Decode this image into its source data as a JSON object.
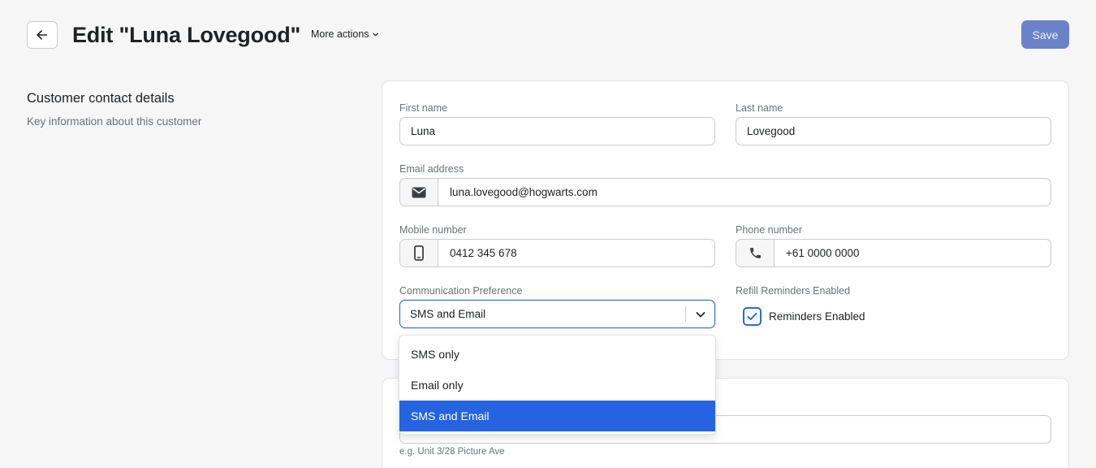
{
  "header": {
    "title": "Edit \"Luna Lovegood\"",
    "more_actions_label": "More actions",
    "save_label": "Save"
  },
  "section": {
    "title": "Customer contact details",
    "description": "Key information about this customer"
  },
  "form": {
    "first_name": {
      "label": "First name",
      "value": "Luna"
    },
    "last_name": {
      "label": "Last name",
      "value": "Lovegood"
    },
    "email": {
      "label": "Email address",
      "value": "luna.lovegood@hogwarts.com",
      "icon": "envelope-icon"
    },
    "mobile": {
      "label": "Mobile number",
      "value": "0412 345 678",
      "icon": "mobile-phone-icon"
    },
    "phone": {
      "label": "Phone number",
      "value": "+61 0000 0000",
      "icon": "phone-icon"
    },
    "communication_preference": {
      "label": "Communication Preference",
      "value": "SMS and Email",
      "options": [
        "SMS only",
        "Email only",
        "SMS and Email"
      ],
      "selected_index": 2
    },
    "refill_reminders": {
      "label": "Refill Reminders Enabled",
      "checkbox_label": "Reminders Enabled",
      "checked": true
    },
    "address_help": "e.g. Unit 3/28 Picture Ave"
  },
  "colors": {
    "primary": "#2c6ecb",
    "save_button": "#6c82c8",
    "selected_option": "#2563e0"
  }
}
